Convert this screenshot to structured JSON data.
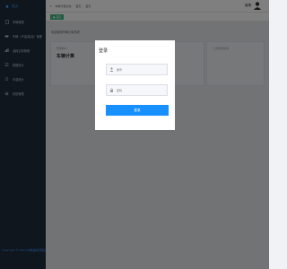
{
  "sidebar": {
    "logo": "首页",
    "items": [
      {
        "label": "车辆管理",
        "icon": "file-icon"
      },
      {
        "label": "车辆（汽油/柴油）管理",
        "icon": "car-icon"
      },
      {
        "label": "油耗记录管理",
        "icon": "chart-icon"
      },
      {
        "label": "数据统计",
        "icon": "list-icon"
      },
      {
        "label": "车载统计",
        "icon": "stats-icon"
      },
      {
        "label": "系统管理",
        "icon": "gear-icon"
      }
    ],
    "footer": "Copyright © 2021 车辆油耗管理系统"
  },
  "header": {
    "breadcrumb": [
      "车辆计量系统",
      "首页",
      "首页"
    ],
    "user_name": "管理"
  },
  "tagbar": {
    "active_tag": "首页"
  },
  "main": {
    "welcome": "欢迎使用车辆计量系统",
    "cards": [
      {
        "title": "登录用户",
        "value": "车辆计算"
      },
      {
        "title": "系统时间",
        "value": ""
      },
      {
        "title": "上次登录时间",
        "value": ""
      }
    ]
  },
  "dialog": {
    "title": "登录",
    "username_placeholder": "账号",
    "password_placeholder": "密码",
    "login_label": "登录"
  },
  "colors": {
    "sidebar_bg": "#1f2d3d",
    "accent": "#1890ff",
    "tag_green": "#42b983"
  }
}
